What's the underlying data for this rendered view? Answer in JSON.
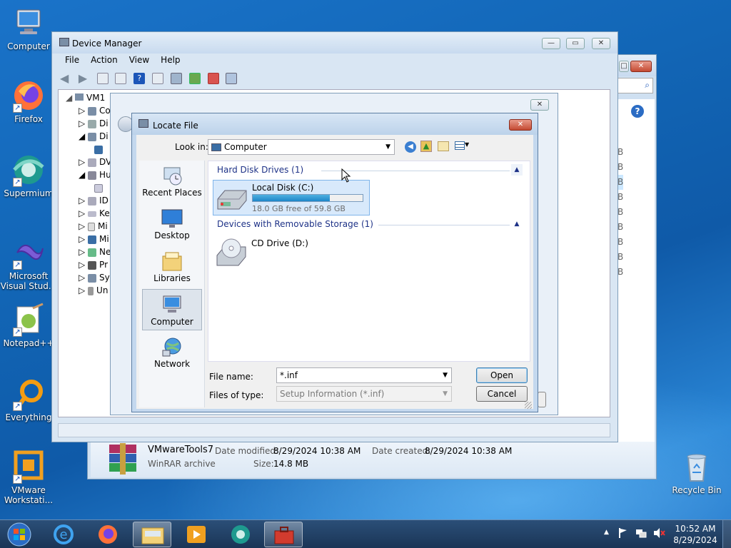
{
  "desktop": {
    "icons": [
      {
        "label": "Computer",
        "icon": "computer-icon"
      },
      {
        "label": "Firefox",
        "icon": "firefox-icon"
      },
      {
        "label": "Supermium",
        "icon": "supermium-icon"
      },
      {
        "label": "Microsoft Visual Stud...",
        "icon": "visual-studio-icon"
      },
      {
        "label": "Notepad++",
        "icon": "notepadpp-icon"
      },
      {
        "label": "Everything",
        "icon": "everything-icon"
      },
      {
        "label": "VMware Workstati...",
        "icon": "vmware-icon"
      },
      {
        "label": "Recycle Bin",
        "icon": "recycle-bin-icon"
      }
    ]
  },
  "device_manager": {
    "title": "Device Manager",
    "menu": [
      "File",
      "Action",
      "View",
      "Help"
    ],
    "tree": {
      "root": "VM1",
      "items": [
        "Co",
        "Di",
        "Di",
        "DV",
        "Hu",
        "ID",
        "Ke",
        "Mi",
        "Mi",
        "Ne",
        "Pr",
        "Sy",
        "Un"
      ]
    }
  },
  "explorer_back": {
    "file": {
      "name": "VMwareTools7",
      "type": "WinRAR archive",
      "modified_label": "Date modified:",
      "modified": "8/29/2024 10:38 AM",
      "created_label": "Date created:",
      "created": "8/29/2024 10:38 AM",
      "size_label": "Size:",
      "size": "14.8 MB"
    },
    "column_fragments": [
      "B",
      "B",
      "B",
      "B",
      "B",
      "B",
      "B",
      "B",
      "B"
    ]
  },
  "locate_file": {
    "title": "Locate File",
    "look_in_label": "Look in:",
    "look_in_value": "Computer",
    "places": [
      "Recent Places",
      "Desktop",
      "Libraries",
      "Computer",
      "Network"
    ],
    "groups": [
      {
        "label": "Hard Disk Drives (1)"
      },
      {
        "label": "Devices with Removable Storage (1)"
      }
    ],
    "drives": [
      {
        "name": "Local Disk (C:)",
        "free": "18.0 GB free of 59.8 GB",
        "used_fraction": 0.7
      },
      {
        "name": "CD Drive (D:)"
      }
    ],
    "file_name_label": "File name:",
    "file_name_value": "*.inf",
    "files_of_type_label": "Files of type:",
    "files_of_type_value": "Setup Information (*.inf)",
    "open_label": "Open",
    "cancel_label": "Cancel"
  },
  "taskbar": {
    "time": "10:52 AM",
    "date": "8/29/2024"
  }
}
